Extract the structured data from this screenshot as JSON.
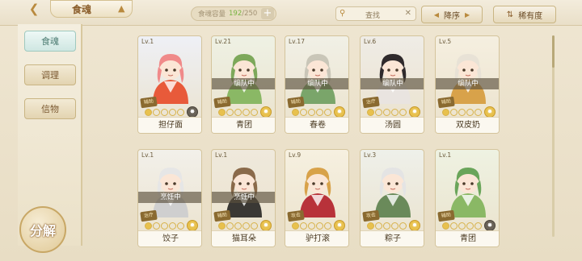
{
  "header": {
    "title": "食魂",
    "capacity_label": "食魂容量",
    "capacity_count": "192",
    "capacity_max": "/250",
    "search_placeholder": "查找",
    "sort_order_label": "降序",
    "sort_by_label": "稀有度"
  },
  "sidebar": {
    "tabs": [
      {
        "label": "食魂",
        "active": true
      },
      {
        "label": "调理",
        "active": false
      },
      {
        "label": "信物",
        "active": false
      }
    ],
    "decompose_label": "分解"
  },
  "cards": [
    {
      "level": "Lv.1",
      "name": "担仔面",
      "status": "",
      "role": "辅助",
      "stars_on": 1,
      "element": "dark",
      "hair": "#f08a8a",
      "outfit": "#e85a3a",
      "bg": "#eef0f6"
    },
    {
      "level": "Lv.21",
      "name": "青团",
      "status": "编队中",
      "role": "辅助",
      "stars_on": 1,
      "element": "light",
      "hair": "#7da85a",
      "outfit": "#8ab865",
      "bg": "#eef1e4"
    },
    {
      "level": "Lv.17",
      "name": "春卷",
      "status": "编队中",
      "role": "辅助",
      "stars_on": 1,
      "element": "light",
      "hair": "#c9c6b8",
      "outfit": "#7aa56a",
      "bg": "#f1f0e6"
    },
    {
      "level": "Lv.6",
      "name": "汤圆",
      "status": "编队中",
      "role": "治疗",
      "stars_on": 1,
      "element": "light",
      "hair": "#2f2a2c",
      "outfit": "#e9e4e0",
      "bg": "#efece6"
    },
    {
      "level": "Lv.5",
      "name": "双皮奶",
      "status": "编队中",
      "role": "辅助",
      "stars_on": 1,
      "element": "light",
      "hair": "#e8e2d6",
      "outfit": "#d8a24a",
      "bg": "#f5efe0"
    },
    {
      "level": "Lv.1",
      "name": "饺子",
      "status": "烹饪中",
      "role": "治疗",
      "stars_on": 1,
      "element": "light",
      "hair": "#e6e6e6",
      "outfit": "#cfcfcf",
      "bg": "#f2f0ea"
    },
    {
      "level": "Lv.1",
      "name": "猫耳朵",
      "status": "烹饪中",
      "role": "辅助",
      "stars_on": 1,
      "element": "light",
      "hair": "#8a6a4a",
      "outfit": "#3a3834",
      "bg": "#efe9dc"
    },
    {
      "level": "Lv.9",
      "name": "驴打滚",
      "status": "",
      "role": "攻击",
      "stars_on": 1,
      "element": "light",
      "hair": "#d8a24a",
      "outfit": "#b8323a",
      "bg": "#f6f0e0"
    },
    {
      "level": "Lv.3",
      "name": "粽子",
      "status": "",
      "role": "攻击",
      "stars_on": 1,
      "element": "light",
      "hair": "#e4e4e4",
      "outfit": "#6a8a5a",
      "bg": "#eef0ea"
    },
    {
      "level": "Lv.1",
      "name": "青团",
      "status": "",
      "role": "辅助",
      "stars_on": 1,
      "element": "dark",
      "hair": "#6aa55a",
      "outfit": "#8ab865",
      "bg": "#eef2e2"
    }
  ]
}
